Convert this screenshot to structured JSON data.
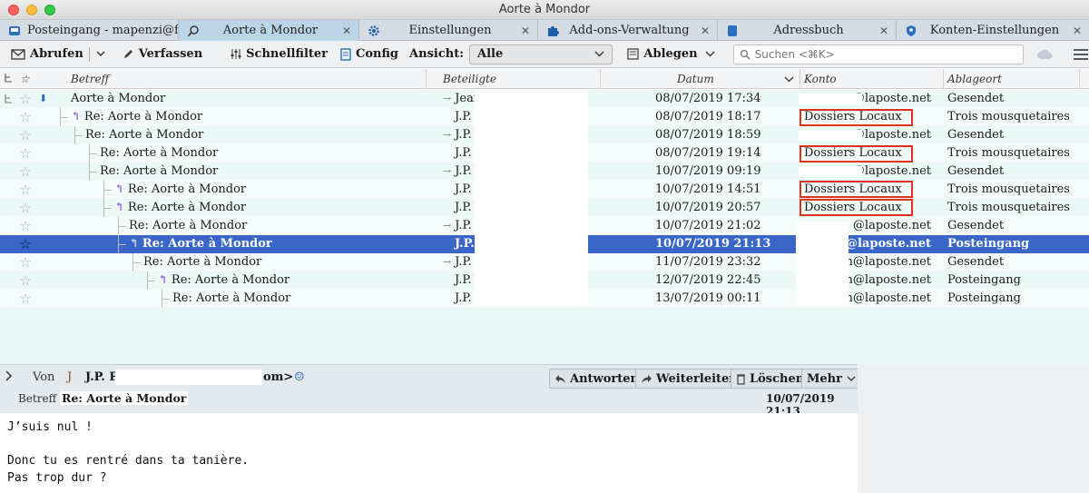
{
  "window": {
    "title": "Aorte à Mondor"
  },
  "tabs": [
    {
      "label": "Posteingang - mapenzi@fr",
      "icon": "inbox-icon",
      "active": false
    },
    {
      "label": "Aorte à Mondor",
      "icon": "search-icon",
      "active": true
    },
    {
      "label": "Einstellungen",
      "icon": "gear-icon",
      "active": false
    },
    {
      "label": "Add-ons-Verwaltung",
      "icon": "puzzle-icon",
      "active": false
    },
    {
      "label": "Adressbuch",
      "icon": "address-book-icon",
      "active": false
    },
    {
      "label": "Konten-Einstellungen",
      "icon": "account-settings-icon",
      "active": false
    }
  ],
  "toolbar": {
    "fetch": "Abrufen",
    "compose": "Verfassen",
    "quickfilter": "Schnellfilter",
    "config": "Config",
    "view_label": "Ansicht:",
    "view_value": "Alle",
    "archive": "Ablegen",
    "search_placeholder": "Suchen <⌘K>"
  },
  "columns": {
    "subject": "Betreff",
    "participants": "Beteiligte",
    "date": "Datum",
    "account": "Konto",
    "location": "Ablageort"
  },
  "messages": [
    {
      "subject": "Aorte à Mondor",
      "participant": "Jean I",
      "date": "08/07/2019 17:34",
      "account": "@laposte.net",
      "location": "Gesendet",
      "sent": true,
      "reply": false
    },
    {
      "subject": "Re: Aorte à Mondor",
      "participant": "J.P. Po",
      "date": "08/07/2019 18:17",
      "account": "Dossiers Locaux",
      "location": "Trois mousquetaires",
      "sent": false,
      "reply": true
    },
    {
      "subject": "Re: Aorte à Mondor",
      "participant": "J.P. Po",
      "date": "08/07/2019 18:59",
      "account": "@laposte.net",
      "location": "Gesendet",
      "sent": true,
      "reply": false
    },
    {
      "subject": "Re: Aorte à Mondor",
      "participant": "J.P. Po",
      "date": "08/07/2019 19:14",
      "account": "Dossiers Locaux",
      "location": "Trois mousquetaires",
      "sent": false,
      "reply": false
    },
    {
      "subject": "Re: Aorte à Mondor",
      "participant": "J.P. Po",
      "date": "10/07/2019 09:19",
      "account": "@laposte.net",
      "location": "Gesendet",
      "sent": true,
      "reply": false
    },
    {
      "subject": "Re: Aorte à Mondor",
      "participant": "J.P. Po",
      "date": "10/07/2019 14:51",
      "account": "Dossiers Locaux",
      "location": "Trois mousquetaires",
      "sent": false,
      "reply": true
    },
    {
      "subject": "Re: Aorte à Mondor",
      "participant": "J.P. Po",
      "date": "10/07/2019 20:57",
      "account": "Dossiers Locaux",
      "location": "Trois mousquetaires",
      "sent": false,
      "reply": true
    },
    {
      "subject": "Re: Aorte à Mondor",
      "participant": "J.P. Po",
      "date": "10/07/2019 21:02",
      "account": "@laposte.net",
      "location": "Gesendet",
      "sent": true,
      "reply": false
    },
    {
      "subject": "Re: Aorte à Mondor",
      "participant": "J.P. Po",
      "date": "10/07/2019 21:13",
      "account": "n@laposte.net",
      "location": "Posteingang",
      "sent": false,
      "reply": true,
      "selected": true
    },
    {
      "subject": "Re: Aorte à Mondor",
      "participant": "J.P. Po",
      "date": "11/07/2019 23:32",
      "account": "n@laposte.net",
      "location": "Gesendet",
      "sent": true,
      "reply": false
    },
    {
      "subject": "Re: Aorte à Mondor",
      "participant": "J.P. Po",
      "date": "12/07/2019 22:45",
      "account": "n@laposte.net",
      "location": "Posteingang",
      "sent": false,
      "reply": true
    },
    {
      "subject": "Re: Aorte à Mondor",
      "participant": "J.P. Po",
      "date": "13/07/2019 00:11",
      "account": "n@laposte.net",
      "location": "Posteingang",
      "sent": false,
      "reply": false
    }
  ],
  "preview": {
    "from_label": "Von",
    "from_initial": "J",
    "from_name": "J.P. P",
    "from_tail": "om>",
    "subject_label": "Betreff",
    "subject": "Re: Aorte à Mondor",
    "date": "10/07/2019 21:13",
    "buttons": {
      "reply": "Antworten",
      "forward": "Weiterleiten",
      "delete": "Löschen",
      "more": "Mehr"
    },
    "body": "J’suis nul !\n\nDonc tu es rentré dans ta tanière.\nPas trop dur ?"
  },
  "colors": {
    "selection": "#3a66c7",
    "annotation_box": "#e0331d",
    "reply_arrow": "#7a3fd1"
  }
}
